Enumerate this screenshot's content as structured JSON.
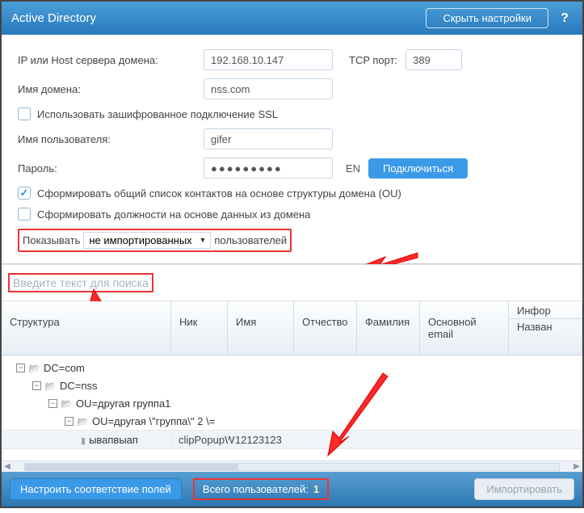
{
  "titlebar": {
    "title": "Active Directory",
    "hide_settings_label": "Скрыть настройки",
    "help_label": "?"
  },
  "settings": {
    "ip_label": "IP или Host сервера домена:",
    "ip_value": "192.168.10.147",
    "tcp_port_label": "TCP порт:",
    "tcp_port_value": "389",
    "domain_label": "Имя домена:",
    "domain_value": "nss.com",
    "ssl_label": "Использовать зашифрованное подключение SSL",
    "ssl_checked": false,
    "user_label": "Имя пользователя:",
    "user_value": "gifer",
    "pass_label": "Пароль:",
    "pass_value": "●●●●●●●●●",
    "lang_label": "EN",
    "connect_label": "Подключиться",
    "ou_label": "Сформировать общий список контактов на основе структуры домена (OU)",
    "ou_checked": true,
    "titles_label": "Сформировать должности на основе данных из домена",
    "titles_checked": false,
    "filter_prefix": "Показывать",
    "filter_value": "не импортированных",
    "filter_suffix": "пользователей"
  },
  "search": {
    "placeholder": "Введите текст для поиска"
  },
  "grid": {
    "columns": {
      "structure": "Структура",
      "nick": "Ник",
      "name": "Имя",
      "patronymic": "Отчество",
      "surname": "Фамилия",
      "main_email": "Основной email",
      "info_group": "Инфор",
      "info_sub": "Назван"
    },
    "tree": [
      {
        "level": 1,
        "label": "DC=com"
      },
      {
        "level": 2,
        "label": "DC=nss"
      },
      {
        "level": 3,
        "label": "OU=другая группа1"
      },
      {
        "level": 4,
        "label": "OU=другая \\\"группа\\\" 2 \\="
      }
    ],
    "leaf": {
      "structure": "ывапвыап",
      "nick": "clipPopupW",
      "name": "12123123"
    }
  },
  "footer": {
    "map_fields_label": "Настроить соответствие полей",
    "total_label": "Всего пользователей:",
    "total_count": "1",
    "import_label": "Импортировать"
  }
}
